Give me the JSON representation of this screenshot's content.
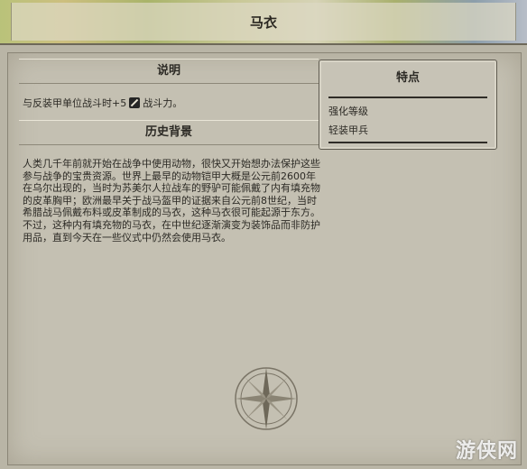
{
  "header": {
    "title": "马衣"
  },
  "description": {
    "heading": "说明",
    "line_prefix": "与反装甲单位战斗时+5",
    "icon": "melee-strength-icon",
    "line_suffix": "战斗力。"
  },
  "history": {
    "heading": "历史背景",
    "text": "人类几千年前就开始在战争中使用动物，很快又开始想办法保护这些参与战争的宝贵资源。世界上最早的动物铠甲大概是公元前2600年在乌尔出现的，当时为苏美尔人拉战车的野驴可能佩戴了内有填充物的皮革胸甲；欧洲最早关于战马盔甲的证据来自公元前8世纪，当时希腊战马佩戴布料或皮革制成的马衣，这种马衣很可能起源于东方。不过，这种内有填充物的马衣，在中世纪逐渐演变为装饰品而非防护用品，直到今天在一些仪式中仍然会使用马衣。"
  },
  "traits": {
    "heading": "特点",
    "items": [
      "强化等级",
      "轻装甲兵"
    ]
  },
  "watermark": "游侠网",
  "colors": {
    "panel": "#c4c0b2",
    "text": "#2c2a25",
    "rule": "#2f2c27"
  }
}
